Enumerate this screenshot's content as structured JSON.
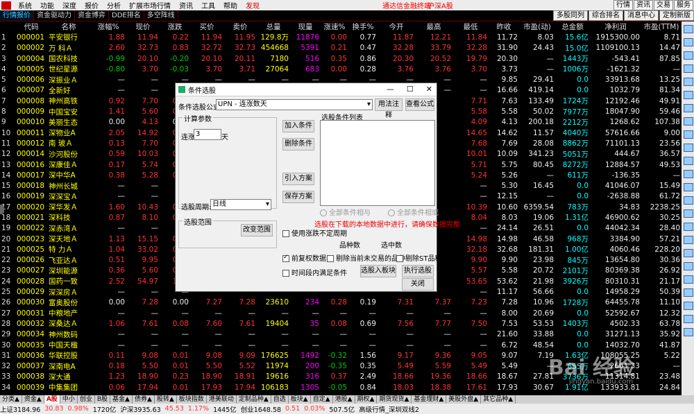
{
  "menubar": {
    "items": [
      "系统",
      "功能",
      "深度",
      "报价",
      "分析",
      "扩展市场行情",
      "资讯",
      "工具",
      "帮助"
    ],
    "highlight": "发现",
    "center1": "通达信金融终端",
    "center2": "沪深A股",
    "right": [
      "行情",
      "资讯",
      "交易",
      "服务"
    ]
  },
  "tabs": {
    "items": [
      "行情报价",
      "资金驱动力",
      "资金博弈",
      "DDE排名",
      "多空阵线"
    ],
    "right": [
      "多股同列",
      "综合排名",
      "消息中心",
      "定制新版"
    ]
  },
  "table": {
    "headers": [
      "",
      "代码",
      "名称",
      "涨幅%",
      "现价",
      "涨跌",
      "买价",
      "卖价",
      "总量",
      "现量",
      "涨速%",
      "换手%",
      "今开",
      "最高",
      "最低",
      "昨收",
      "市盈(动)",
      "总金额",
      "净利润",
      "市盈(TTM)"
    ],
    "rows": [
      [
        "1",
        "000001",
        "平安银行",
        "1.88",
        "11.94",
        "0.22",
        "11.94",
        "11.95",
        "129.8万",
        "11876",
        "0.00",
        "0.77",
        "11.87",
        "12.21",
        "11.84",
        "11.72",
        "8.03",
        "15.6亿",
        "1915300.00",
        "8.71"
      ],
      [
        "2",
        "000002",
        "万 科Ａ",
        "2.60",
        "32.73",
        "0.83",
        "32.72",
        "32.73",
        "454668",
        "5391",
        "0.21",
        "0.47",
        "32.28",
        "33.79",
        "32.28",
        "31.90",
        "24.43",
        "15.0亿",
        "1109100.13",
        "14.47"
      ],
      [
        "3",
        "000004",
        "国农科技",
        "-0.99",
        "20.10",
        "-0.20",
        "20.10",
        "20.11",
        "7180",
        "516",
        "0.35",
        "0.86",
        "20.30",
        "20.52",
        "19.79",
        "20.30",
        "—",
        "1443万",
        "-543.41",
        "87.85"
      ],
      [
        "4",
        "000005",
        "世纪星源",
        "-0.80",
        "3.70",
        "-0.03",
        "3.70",
        "3.71",
        "27064",
        "683",
        "0.00",
        "0.28",
        "3.76",
        "3.76",
        "3.70",
        "3.73",
        "—",
        "1006万",
        "-1621.32",
        "—"
      ],
      [
        "5",
        "000006",
        "深振业Ａ",
        "—",
        "—",
        "—",
        "—",
        "—",
        "—",
        "—",
        "—",
        "—",
        "—",
        "—",
        "—",
        "9.85",
        "29.41",
        "0.0",
        "33913.68",
        "13.25"
      ],
      [
        "6",
        "000007",
        "全新好",
        "—",
        "—",
        "—",
        "—",
        "—",
        "—",
        "—",
        "—",
        "—",
        "—",
        "—",
        "—",
        "16.66",
        "419.14",
        "0.0",
        "1032.79",
        "81.34"
      ],
      [
        "7",
        "000008",
        "神州高铁",
        "0.92",
        "7.70",
        "0.07",
        "",
        "",
        "",
        "",
        "",
        "",
        "",
        "",
        "7.71",
        "7.63",
        "133.49",
        "1724万",
        "12192.46",
        "49.91"
      ],
      [
        "8",
        "000009",
        "中国宝安",
        "1.41",
        "5.60",
        "0.08",
        "",
        "",
        "",
        "",
        "",
        "",
        "",
        "",
        "5.58",
        "5.58",
        "50.02",
        "7977万",
        "18047.90",
        "59.46"
      ],
      [
        "9",
        "000010",
        "美丽生态",
        "0.00",
        "4.13",
        "0.00",
        "",
        "",
        "",
        "",
        "",
        "",
        "",
        "",
        "4.09",
        "4.13",
        "200.18",
        "2212万",
        "1268.62",
        "107.38"
      ],
      [
        "10",
        "000011",
        "深物业A",
        "2.05",
        "14.92",
        "0.30",
        "",
        "",
        "",
        "",
        "",
        "",
        "",
        "",
        "14.65",
        "14.62",
        "11.57",
        "4040万",
        "57616.66",
        "9.00"
      ],
      [
        "11",
        "000012",
        "南 玻Ａ",
        "0.13",
        "7.70",
        "0.01",
        "",
        "",
        "",
        "",
        "",
        "",
        "",
        "",
        "7.68",
        "7.69",
        "28.08",
        "8862万",
        "71101.13",
        "23.56"
      ],
      [
        "12",
        "000014",
        "沙河股份",
        "0.59",
        "10.03",
        "0.06",
        "",
        "",
        "",
        "",
        "",
        "",
        "",
        "",
        "10.01",
        "10.09",
        "341.23",
        "5051万",
        "444.67",
        "36.57"
      ],
      [
        "13",
        "000016",
        "深康佳Ａ",
        "0.17",
        "5.74",
        "0.01",
        "",
        "",
        "",
        "",
        "",
        "",
        "",
        "",
        "5.71",
        "5.75",
        "80.45",
        "8272万",
        "12884.57",
        "49.53"
      ],
      [
        "14",
        "000017",
        "深中华A",
        "0.38",
        "5.28",
        "0.02",
        "",
        "",
        "",
        "",
        "",
        "",
        "",
        "",
        "5.24",
        "5.26",
        "—",
        "611万",
        "-136.35",
        "—"
      ],
      [
        "15",
        "000018",
        "神州长城",
        "—",
        "—",
        "—",
        "",
        "",
        "",
        "",
        "",
        "",
        "",
        "",
        "—",
        "5.30",
        "16.45",
        "0.0",
        "41046.07",
        "15.49"
      ],
      [
        "16",
        "000019",
        "深深宝Ａ",
        "—",
        "—",
        "—",
        "",
        "",
        "",
        "",
        "",
        "",
        "",
        "",
        "—",
        "12.15",
        "—",
        "0.0",
        "-2638.88",
        "61.72"
      ],
      [
        "17",
        "000020",
        "深华发Ａ",
        "1.60",
        "10.43",
        "0.17",
        "",
        "",
        "",
        "",
        "",
        "",
        "",
        "",
        "10.39",
        "10.60",
        "6359.54",
        "783万",
        "34.83",
        "2238.25"
      ],
      [
        "18",
        "000021",
        "深科技",
        "0.87",
        "8.10",
        "0.07",
        "",
        "",
        "",
        "",
        "",
        "",
        "",
        "",
        "8.04",
        "8.03",
        "19.06",
        "1.31亿",
        "46900.62",
        "30.25"
      ],
      [
        "19",
        "000022",
        "深赤湾Ａ",
        "—",
        "—",
        "—",
        "",
        "",
        "",
        "",
        "",
        "",
        "",
        "",
        "—",
        "24.14",
        "26.51",
        "0.0",
        "44042.34",
        "28.40"
      ],
      [
        "20",
        "000023",
        "深天地Ａ",
        "1.13",
        "15.15",
        "0.17",
        "",
        "",
        "",
        "",
        "",
        "",
        "",
        "",
        "14.98",
        "14.98",
        "46.58",
        "968万",
        "3384.90",
        "57.21"
      ],
      [
        "21",
        "000025",
        "特 力Ａ",
        "1.04",
        "33.02",
        "0.34",
        "",
        "",
        "",
        "",
        "",
        "",
        "",
        "",
        "32.18",
        "32.68",
        "181.31",
        "1.00亿",
        "4060.46",
        "228.20"
      ],
      [
        "22",
        "000026",
        "飞亚达Ａ",
        "0.51",
        "9.95",
        "0.05",
        "",
        "",
        "",
        "",
        "",
        "",
        "",
        "",
        "9.90",
        "9.90",
        "23.98",
        "845万",
        "13654.80",
        "30.36"
      ],
      [
        "23",
        "000027",
        "深圳能源",
        "0.36",
        "5.60",
        "0.02",
        "",
        "",
        "",
        "",
        "",
        "",
        "",
        "",
        "5.57",
        "5.58",
        "20.72",
        "2101万",
        "80369.38",
        "26.92"
      ],
      [
        "24",
        "000028",
        "国药一致",
        "2.52",
        "54.97",
        "1.35",
        "",
        "",
        "",
        "",
        "",
        "",
        "",
        "",
        "53.65",
        "53.62",
        "21.98",
        "3926万",
        "80310.31",
        "21.17"
      ],
      [
        "25",
        "000029",
        "深深房Ａ",
        "—",
        "—",
        "—",
        "",
        "",
        "",
        "",
        "",
        "",
        "",
        "",
        "—",
        "11.17",
        "56.66",
        "0.0",
        "14958.29",
        "50.39"
      ],
      [
        "26",
        "000030",
        "富奥股份",
        "0.00",
        "7.28",
        "0.00",
        "7.27",
        "7.28",
        "23610",
        "234",
        "0.28",
        "0.19",
        "7.31",
        "7.37",
        "7.23",
        "7.28",
        "10.96",
        "1728万",
        "64455.78",
        "11.10"
      ],
      [
        "27",
        "000031",
        "中粮地产",
        "—",
        "—",
        "—",
        "—",
        "—",
        "—",
        "—",
        "—",
        "—",
        "—",
        "—",
        "—",
        "8.00",
        "20.69",
        "0.0",
        "52592.67",
        "12.32"
      ],
      [
        "28",
        "000032",
        "深桑达Ａ",
        "1.06",
        "7.61",
        "0.08",
        "7.60",
        "7.61",
        "19404",
        "35",
        "0.08",
        "0.69",
        "7.56",
        "7.77",
        "7.50",
        "7.53",
        "53.53",
        "1403万",
        "4502.33",
        "63.78"
      ],
      [
        "29",
        "000034",
        "神州数码",
        "—",
        "—",
        "—",
        "—",
        "—",
        "—",
        "—",
        "—",
        "—",
        "—",
        "—",
        "—",
        "21.60",
        "33.88",
        "0.0",
        "31271.13",
        "35.92"
      ],
      [
        "30",
        "000035",
        "中国天楹",
        "—",
        "—",
        "—",
        "—",
        "—",
        "—",
        "—",
        "—",
        "—",
        "—",
        "—",
        "—",
        "6.72",
        "48.54",
        "0.0",
        "14032.70",
        "41.87"
      ],
      [
        "31",
        "000036",
        "华联控股",
        "0.11",
        "9.08",
        "0.01",
        "9.08",
        "9.09",
        "176625",
        "1492",
        "-0.32",
        "1.56",
        "9.17",
        "9.36",
        "9.05",
        "9.07",
        "7.19",
        "1.63亿",
        "108055.25",
        "5.22"
      ],
      [
        "32",
        "000037",
        "深南电A",
        "0.18",
        "5.50",
        "0.01",
        "5.50",
        "5.52",
        "11974",
        "200",
        "-0.35",
        "0.35",
        "5.49",
        "5.59",
        "5.49",
        "5.49",
        "—",
        "655万",
        "-2661.33",
        "—"
      ],
      [
        "33",
        "000038",
        "深大通",
        "1.23",
        "18.90",
        "0.23",
        "18.90",
        "18.91",
        "19616",
        "316",
        "0.37",
        "2.49",
        "18.66",
        "19.36",
        "18.66",
        "18.67",
        "27.81",
        "3736万",
        "11314.81",
        "23.48"
      ],
      [
        "34",
        "000039",
        "中集集团",
        "0.06",
        "17.94",
        "0.01",
        "17.93",
        "17.94",
        "106183",
        "1305",
        "-0.05",
        "0.84",
        "18.03",
        "18.38",
        "17.61",
        "17.93",
        "30.67",
        "1.91亿",
        "133933.81",
        "24.84"
      ]
    ]
  },
  "dialog": {
    "title": "条件选股",
    "formula_label": "条件选股公式",
    "formula_value": "UPN          - 连涨数天",
    "btn_usage": "用法注释",
    "btn_view": "查看公式",
    "calc_params": "计算参数",
    "param_label": "连涨",
    "param_value": "3",
    "param_unit": "天",
    "list_label": "选股条件列表",
    "btn_add": "加入条件",
    "btn_delete": "删除条件",
    "btn_import": "引入方案",
    "btn_save": "保存方案",
    "period_label": "选股周期:",
    "period_value": "日线",
    "radio_and": "全部条件相与",
    "radio_or": "全部条件相或",
    "range_label": "选股范围",
    "btn_change_range": "改变范围",
    "warn": "选股在下载的本地数据中进行，请确保数据完整",
    "chk_period": "使用涨跌不定周期",
    "count_label1": "品种数",
    "count_label2": "选中数",
    "chk_fq": "前复权数据",
    "chk_exclude_today": "剔除当前未交易的品种",
    "chk_exclude_st": "剔除ST品种",
    "chk_time": "时间段内满足条件",
    "btn_to_block": "选股入板块",
    "btn_execute": "执行选股",
    "btn_close": "关闭",
    "close_glyph": "✕",
    "max_glyph": "☐",
    "min_glyph": "—"
  },
  "bottomtabs": [
    "分类▲",
    "资金▲",
    "A股",
    "中小",
    "创业",
    "B股",
    "基金▲",
    "债券▲",
    "股转▲",
    "板块指数",
    "港美联动",
    "定制品种▲",
    "自选",
    "板块▲",
    "自定▲",
    "港股▲",
    "期权▲",
    "期货现货▲",
    "基金理财▲",
    "美股外盘▲",
    "其它品种▲"
  ],
  "statusbar": {
    "sh": "上证3184.96",
    "sh_chg": "30.83",
    "sh_pct": "0.98%",
    "sh_amt": "1720亿",
    "hs": "沪深3935.63",
    "hs_chg": "45.53",
    "hs_pct": "1.17%",
    "hs_amt": "1445亿",
    "cy": "创业1648.58",
    "cy_chg": "0.51",
    "cy_pct": "0.03%",
    "cy_amt": "507.5亿",
    "info": "高级行情_深圳双线2"
  },
  "watermark": {
    "text": "Bai 经验",
    "sub": "jingyan.baidu.com"
  }
}
